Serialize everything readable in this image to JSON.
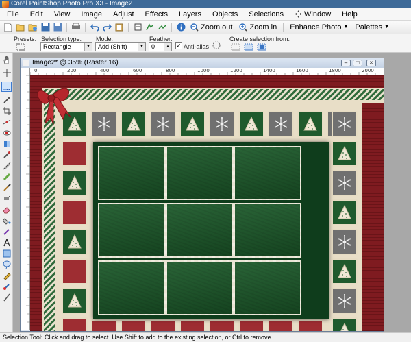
{
  "app": {
    "title": "Corel PaintShop Photo Pro X3 - Image2"
  },
  "menu": [
    "File",
    "Edit",
    "View",
    "Image",
    "Adjust",
    "Effects",
    "Layers",
    "Objects",
    "Selections",
    "Window",
    "Help"
  ],
  "toolbar": {
    "zoom_out_label": "Zoom out",
    "zoom_in_label": "Zoom in",
    "enhance_photo_label": "Enhance Photo",
    "palettes_label": "Palettes"
  },
  "tool_options": {
    "presets_label": "Presets:",
    "selection_type_label": "Selection type:",
    "selection_type_value": "Rectangle",
    "mode_label": "Mode:",
    "mode_value": "Add (Shift)",
    "feather_label": "Feather:",
    "feather_value": "0",
    "antialias_label": "Anti-alias",
    "antialias_checked": true,
    "create_selection_label": "Create selection from:"
  },
  "image_window": {
    "title": "Image2* @ 35% (Raster 16)",
    "ruler_ticks": [
      "0",
      "200",
      "400",
      "600",
      "800",
      "1000",
      "1200",
      "1400",
      "1600",
      "1800",
      "2000"
    ]
  },
  "status_bar": {
    "text": "Selection Tool: Click and drag to select. Use Shift to add to the existing selection, or Ctrl to remove."
  },
  "colors": {
    "titlebar": "#3e6a98",
    "green_tile": "#1f5a2d",
    "red_tile": "#9e2d32",
    "gray_tile": "#707070",
    "frame_green": "#1c5a2a",
    "ribbon_red": "#b5262c"
  }
}
